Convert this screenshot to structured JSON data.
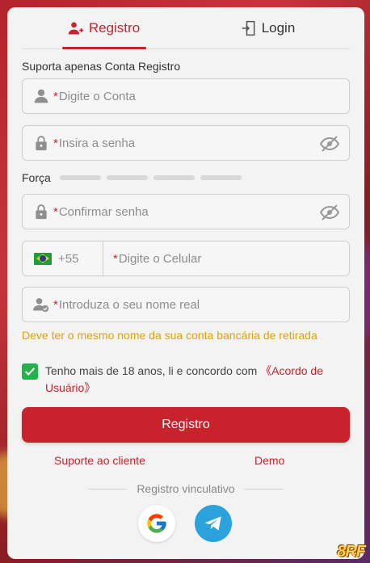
{
  "tabs": [
    {
      "label": "Registro",
      "icon": "add-user-icon",
      "active": true
    },
    {
      "label": "Login",
      "icon": "login-door-icon",
      "active": false
    }
  ],
  "subtitle": "Suporta apenas Conta Registro",
  "fields": {
    "account": {
      "required_mark": "*",
      "placeholder": "Digite o Conta",
      "icon": "user-icon"
    },
    "password": {
      "required_mark": "*",
      "placeholder": "Insira a senha",
      "icon": "lock-icon"
    },
    "strength_label": "Força",
    "confirm": {
      "required_mark": "*",
      "placeholder": "Confirmar senha",
      "icon": "lock-icon"
    },
    "phone": {
      "country_code": "+55",
      "required_mark": "*",
      "placeholder": "Digite o Celular",
      "flag": "brazil-flag-icon"
    },
    "realname": {
      "required_mark": "*",
      "placeholder": "Introduza o seu nome real",
      "icon": "user-check-icon"
    }
  },
  "hint": "Deve ter o mesmo nome da sua conta bancária de retirada",
  "agreement": {
    "checked": true,
    "text": "Tenho mais de 18 anos, li e concordo com ",
    "link": "《Acordo de Usuário》"
  },
  "submit_label": "Registro",
  "links": {
    "support": "Suporte ao cliente",
    "demo": "Demo"
  },
  "divider_label": "Registro vinculativo",
  "brand": "8RF",
  "colors": {
    "accent": "#c8232c",
    "hint": "#e0a300",
    "check": "#22b24c",
    "telegram": "#2aa3dc"
  }
}
